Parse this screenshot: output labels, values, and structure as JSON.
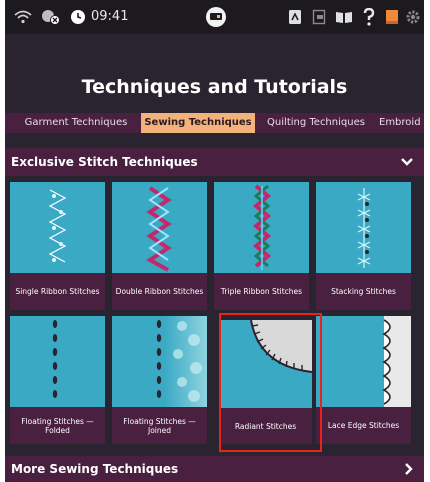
{
  "statusbar": {
    "time": "09:41",
    "icons": [
      "wifi-icon",
      "no-connection-icon",
      "clock-icon",
      "machine-icon",
      "embroidery-card-icon",
      "file-icon",
      "book-icon",
      "help-icon",
      "bookmark-icon",
      "settings-icon"
    ]
  },
  "page": {
    "title": "Techniques and Tutorials"
  },
  "tabs": [
    {
      "label": "Garment Techniques",
      "active": false
    },
    {
      "label": "Sewing Techniques",
      "active": true
    },
    {
      "label": "Quilting Techniques",
      "active": false
    },
    {
      "label": "Embroid",
      "active": false
    }
  ],
  "sections": {
    "exclusive": {
      "title": "Exclusive Stitch Techniques",
      "state_icon": "chevron-down-icon"
    },
    "more": {
      "title": "More Sewing Techniques",
      "state_icon": "chevron-right-icon"
    }
  },
  "tiles": [
    {
      "label": "Single Ribbon Stitches"
    },
    {
      "label": "Double Ribbon Stitches"
    },
    {
      "label": "Triple Ribbon Stitches"
    },
    {
      "label": "Stacking Stitches"
    },
    {
      "label": "Floating Stitches — Folded"
    },
    {
      "label": "Floating Stitches — Joined"
    },
    {
      "label": "Radiant Stitches"
    },
    {
      "label": "Lace Edge Stitches"
    }
  ],
  "colors": {
    "background": "#2a2430",
    "bar": "#4a2040",
    "active_tab": "#f2b27a",
    "tile_fabric": "#3aa9c4",
    "highlight": "#e8231c"
  }
}
